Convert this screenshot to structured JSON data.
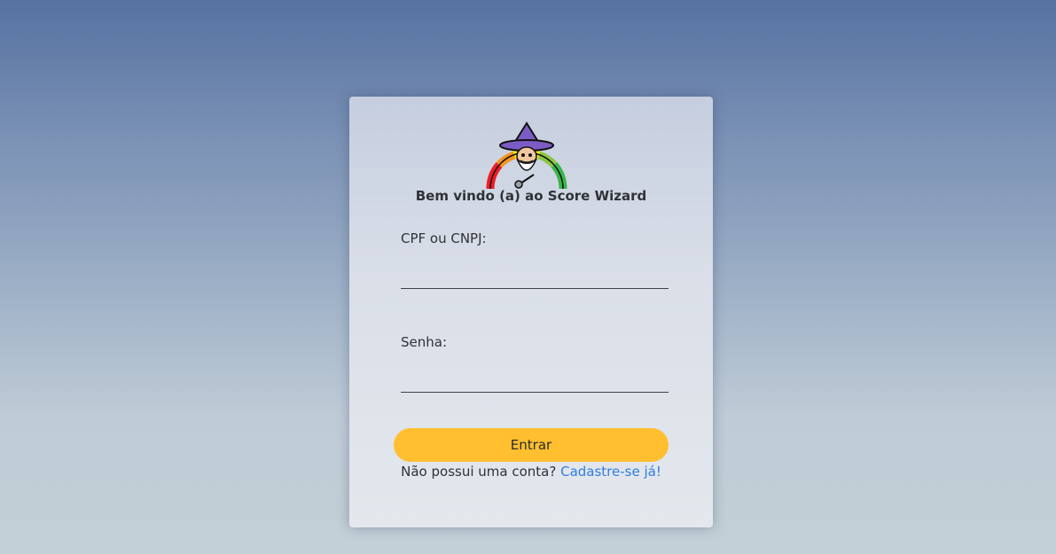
{
  "login": {
    "welcome": "Bem vindo (a) ao Score Wizard",
    "document_label": "CPF ou CNPJ:",
    "document_value": "",
    "password_label": "Senha:",
    "password_value": "",
    "submit_label": "Entrar",
    "signup_prompt": "Não possui uma conta?",
    "signup_link": "Cadastre-se já!"
  },
  "logo": {
    "icon": "wizard-score-gauge-icon",
    "gauge_colors": [
      "#ee1c24",
      "#f7941d",
      "#fff200",
      "#8dc63f",
      "#39b54a"
    ],
    "hat_color": "#7c5cc4"
  },
  "colors": {
    "button": "#ffbf2f",
    "link": "#2f7de1"
  }
}
